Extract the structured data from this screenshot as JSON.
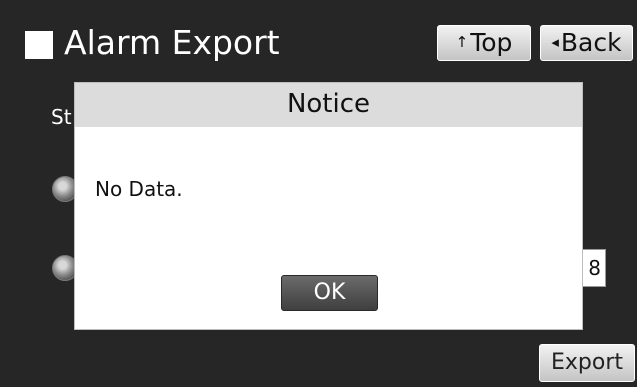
{
  "header": {
    "title": "Alarm Export",
    "top_button": {
      "glyph": "↑",
      "label": "Top"
    },
    "back_button": {
      "glyph": "◂",
      "label": "Back"
    }
  },
  "background": {
    "label_fragment": "St",
    "field_value": "8",
    "export_label": "Export"
  },
  "dialog": {
    "title": "Notice",
    "message": "No Data.",
    "ok_label": "OK"
  },
  "icons": {
    "title_square": "square-icon",
    "top": "up-arrow-icon",
    "back": "left-triangle-icon"
  }
}
